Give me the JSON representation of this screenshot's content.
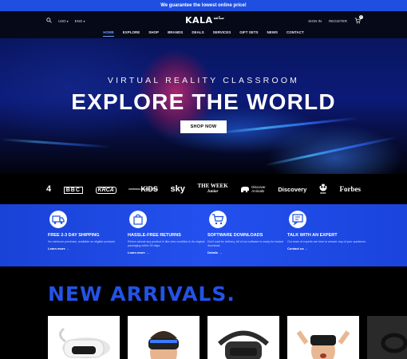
{
  "promo": {
    "text": "We guarantee the lowest online price!"
  },
  "header": {
    "currency": "USD",
    "language": "ENG",
    "logo": "KALA",
    "logo_sub": "ساعة",
    "sign_in": "SIGN IN",
    "register": "REGISTER",
    "cart_count": "0"
  },
  "nav": {
    "items": [
      "HOME",
      "EXPLORE",
      "SHOP",
      "BRANDS",
      "DEALS",
      "SERVICES",
      "GIFT SETS",
      "NEWS",
      "CONTACT"
    ],
    "active": "HOME"
  },
  "hero": {
    "subtitle": "VIRTUAL REALITY CLASSROOM",
    "title": "EXPLORE THE WORLD",
    "button": "SHOP NOW"
  },
  "brands": {
    "items": [
      "4",
      "BBC",
      "KRCA",
      "KIDS",
      "sky",
      "The Week Junior",
      "Discover Animals",
      "Discovery",
      "WWF",
      "Forbes"
    ],
    "kids_small": "NATIONAL GEOGRAPHIC",
    "week_main": "THE WEEK",
    "week_sub": "Junior",
    "animals_main": "Discover",
    "animals_sub": "Animals"
  },
  "features": [
    {
      "title": "FREE 2-3 DAY SHIPPING",
      "desc": "No minimum purchase, available on eligible products",
      "link": "Learn more →"
    },
    {
      "title": "HASSLE-FREE RETURNS",
      "desc": "Return almost any product in like-new condition in its original packaging within 30 days",
      "link": "Learn more →"
    },
    {
      "title": "SOFTWARE DOWNLOADS",
      "desc": "Don't wait for delivery. All of our software is ready for instant download.",
      "link": "Details →"
    },
    {
      "title": "TALK WITH AN EXPERT",
      "desc": "Our team of experts are here to answer any of your questions.",
      "link": "Contact us →"
    }
  ],
  "arrivals": {
    "title": "NEW ARRIVALS."
  },
  "colors": {
    "brand_blue": "#2352e6",
    "promo_blue": "#1f4fe0",
    "features_blue": "#2350ee",
    "nav_active": "#6da0ff"
  }
}
